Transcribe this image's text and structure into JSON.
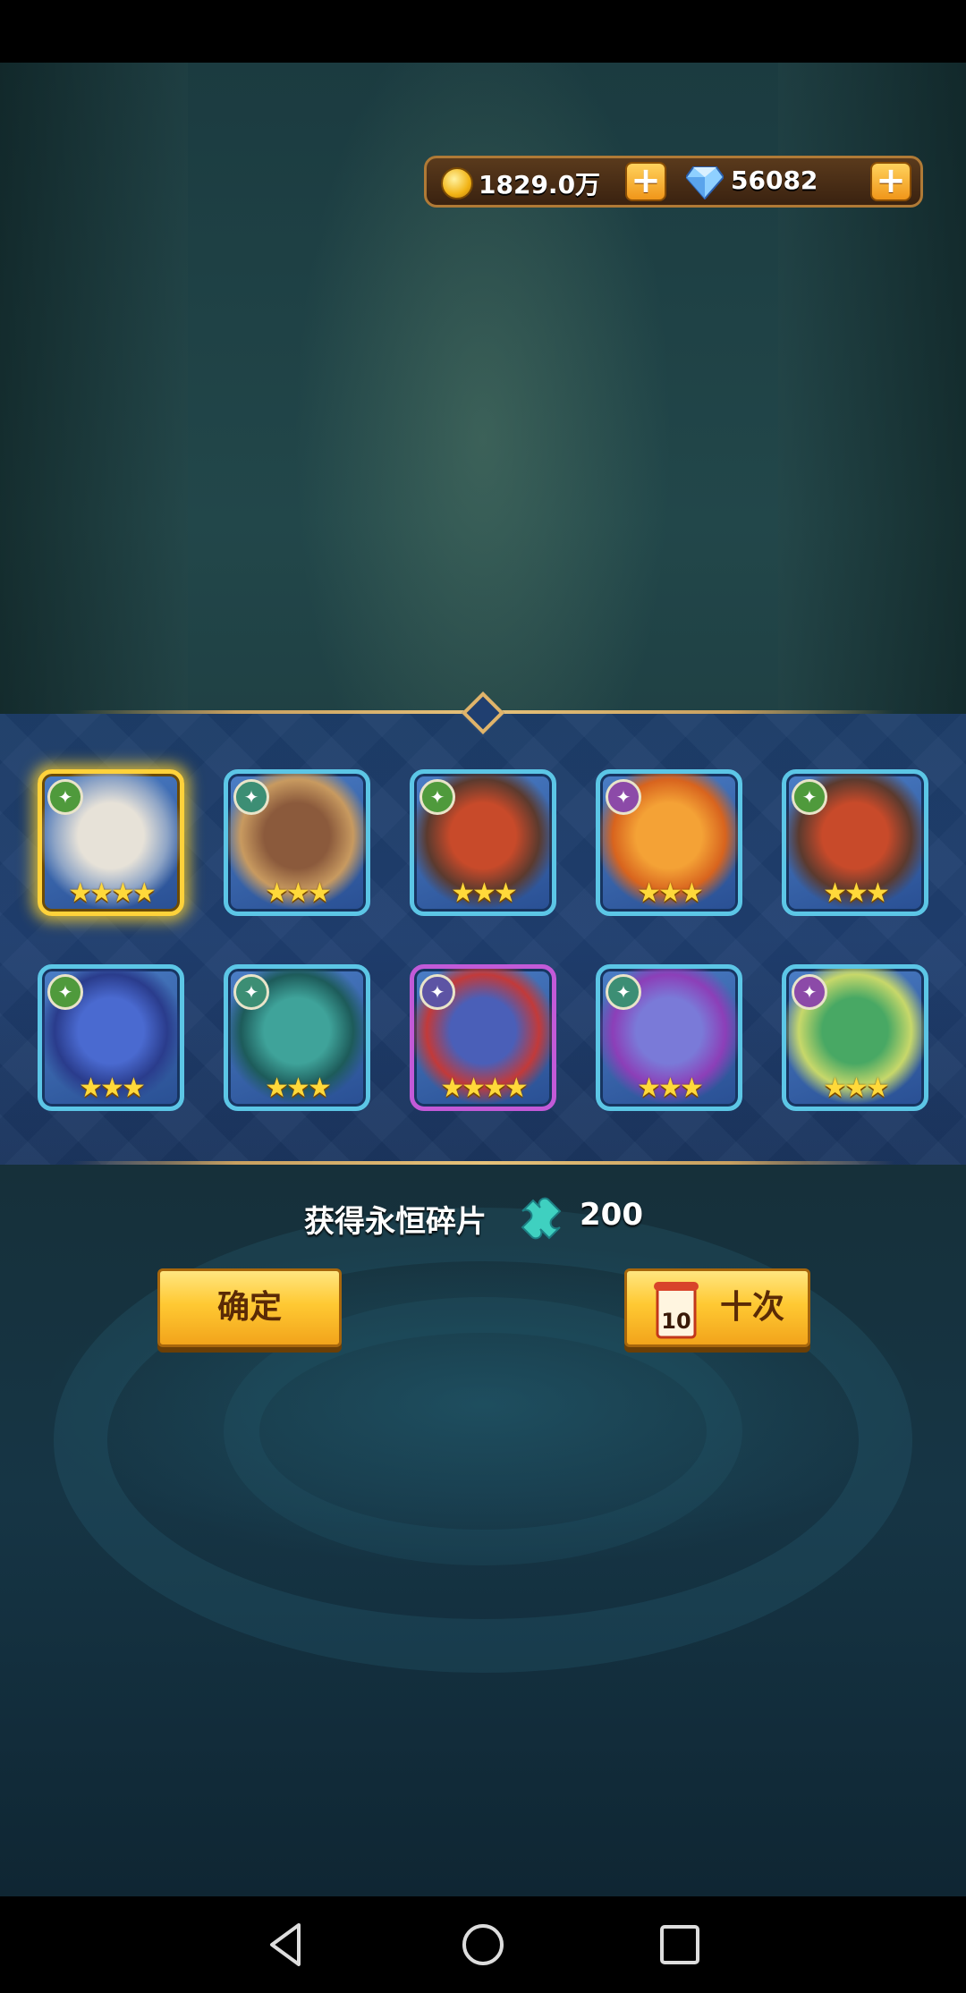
{
  "currency": {
    "gold_value": "1829.0万",
    "gold_icon": "gold-coin-icon",
    "gem_value": "56082",
    "gem_icon": "diamond-gem-icon",
    "add_gold_label": "+",
    "add_gem_label": "+"
  },
  "heroes": [
    {
      "faction": "nature",
      "faction_icon": "leaf-emblem-icon",
      "stars": "★★★★",
      "star_count": 4,
      "frame": "gold",
      "selected": true
    },
    {
      "faction": "forest",
      "faction_icon": "wing-emblem-icon",
      "stars": "★★★",
      "star_count": 3,
      "frame": "blue"
    },
    {
      "faction": "nature",
      "faction_icon": "leaf-emblem-icon",
      "stars": "★★★",
      "star_count": 3,
      "frame": "blue"
    },
    {
      "faction": "shadow",
      "faction_icon": "skull-emblem-icon",
      "stars": "★★★",
      "star_count": 3,
      "frame": "blue"
    },
    {
      "faction": "nature",
      "faction_icon": "leaf-emblem-icon",
      "stars": "★★★",
      "star_count": 3,
      "frame": "blue"
    },
    {
      "faction": "nature",
      "faction_icon": "leaf-emblem-icon",
      "stars": "★★★",
      "star_count": 3,
      "frame": "blue"
    },
    {
      "faction": "forest",
      "faction_icon": "wing-emblem-icon",
      "stars": "★★★",
      "star_count": 3,
      "frame": "blue"
    },
    {
      "faction": "undead",
      "faction_icon": "demon-emblem-icon",
      "stars": "★★★★",
      "star_count": 4,
      "frame": "purple"
    },
    {
      "faction": "forest",
      "faction_icon": "wing-emblem-icon",
      "stars": "★★★",
      "star_count": 3,
      "frame": "blue"
    },
    {
      "faction": "shadow",
      "faction_icon": "skull-emblem-icon",
      "stars": "★★★",
      "star_count": 3,
      "frame": "blue"
    }
  ],
  "reward": {
    "label": "获得永恒碎片",
    "icon": "puzzle-shard-icon",
    "count": "200"
  },
  "buttons": {
    "confirm_label": "确定",
    "ten_label": "十次",
    "ten_ticket_number": "10"
  },
  "colors": {
    "gold_frame": "#ffd23a",
    "blue_frame": "#5cc6e6",
    "purple_frame": "#c25ad8",
    "button_gold": "#ffc933",
    "panel_blue": "#203f70"
  }
}
